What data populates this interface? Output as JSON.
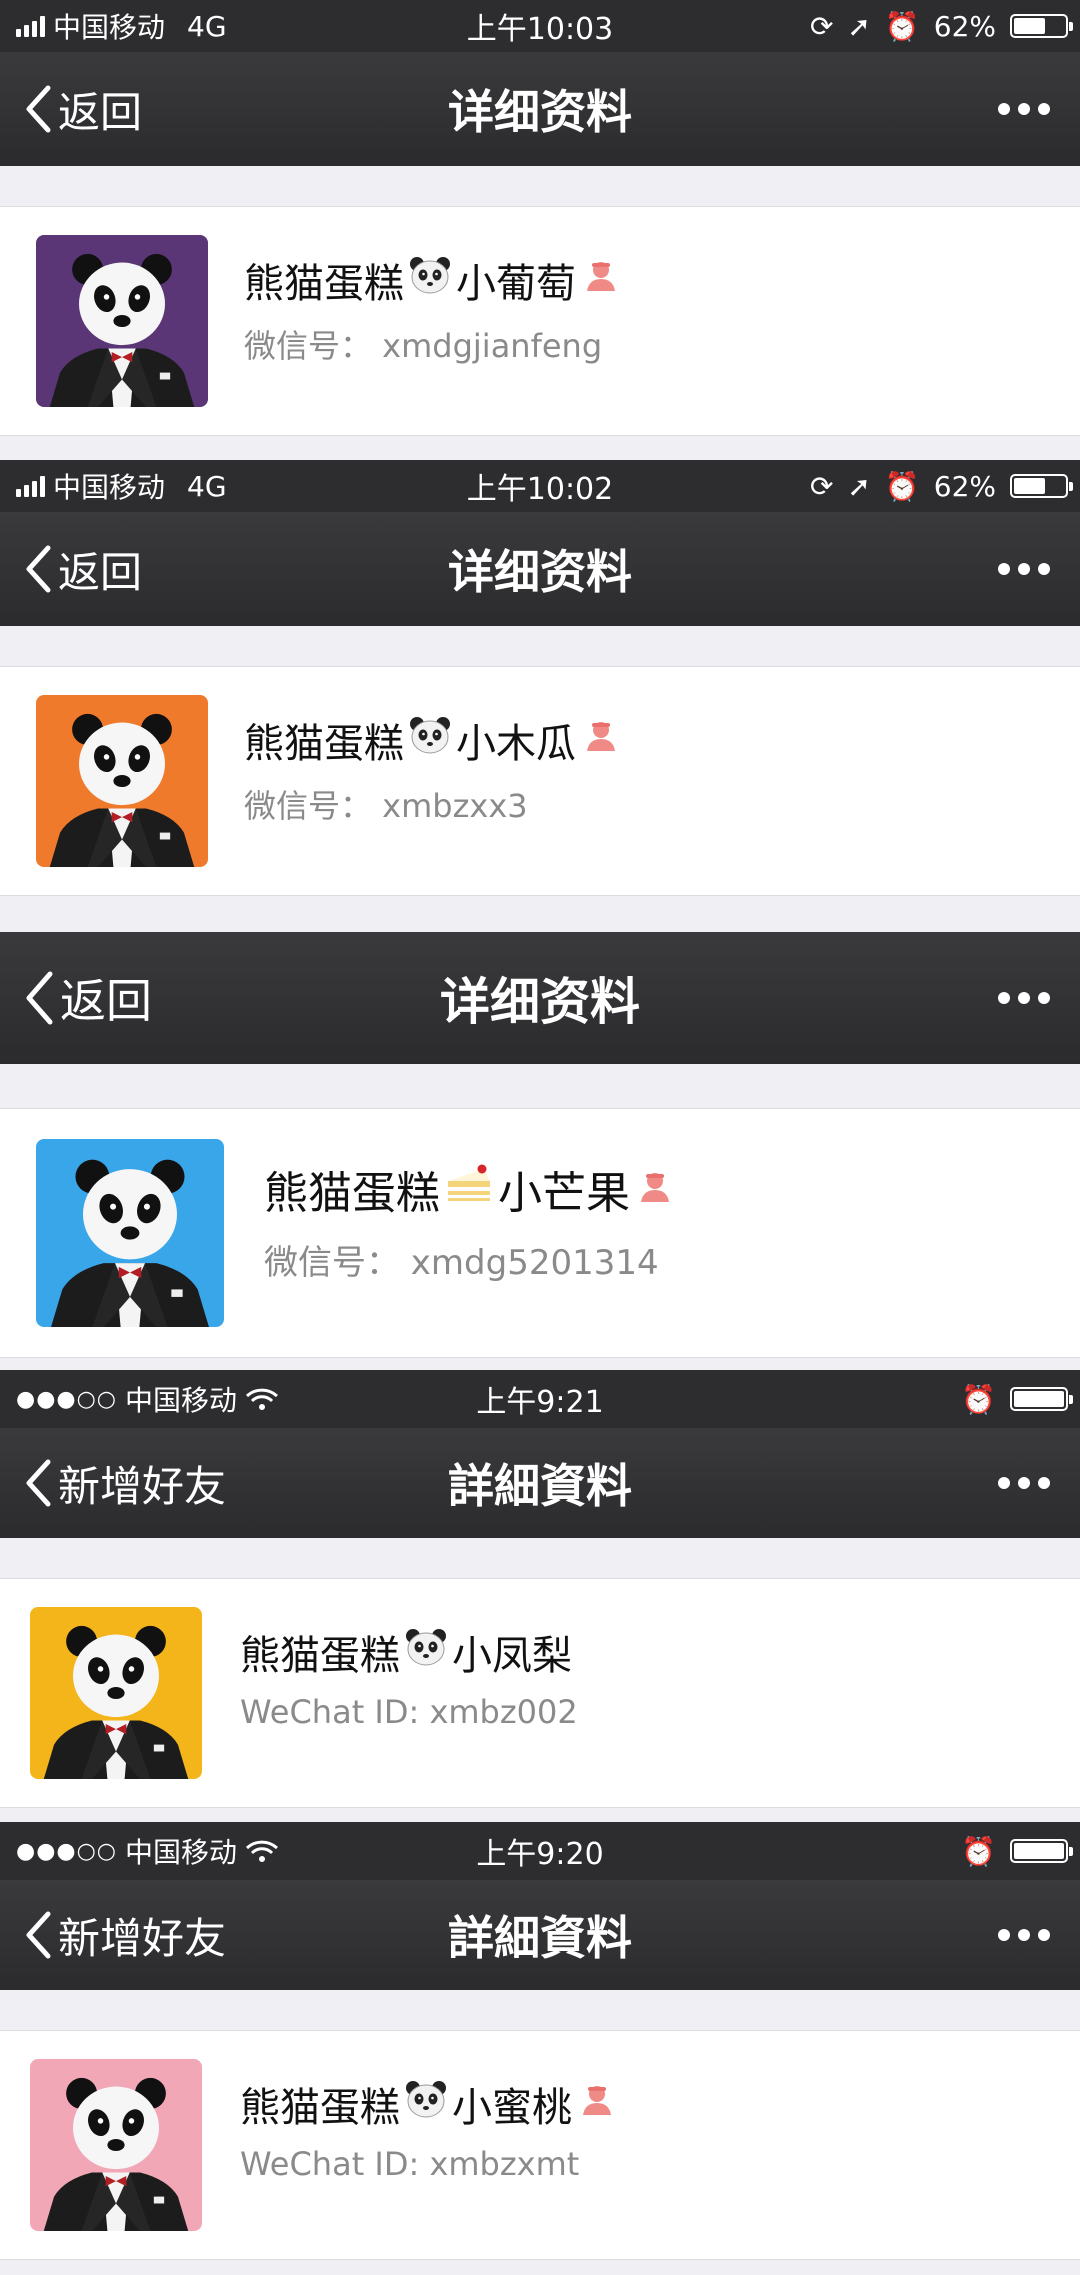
{
  "screens": [
    {
      "status": {
        "carrier": "中国移动",
        "network": "4G",
        "time": "上午10:03",
        "battery": "62%",
        "battery_level": 0.62
      },
      "nav": {
        "back": "返回",
        "title": "详细资料"
      },
      "profile": {
        "name_prefix": "熊猫蛋糕",
        "name_suffix": "小葡萄",
        "emoji_icon": "panda-face-icon",
        "female_icon": true,
        "id_text": "微信号：  xmdgjianfeng",
        "avatar_color": "#5a3676"
      }
    },
    {
      "status": {
        "carrier": "中国移动",
        "network": "4G",
        "time": "上午10:02",
        "battery": "62%",
        "battery_level": 0.62
      },
      "nav": {
        "back": "返回",
        "title": "详细资料"
      },
      "profile": {
        "name_prefix": "熊猫蛋糕",
        "name_suffix": "小木瓜",
        "emoji_icon": "panda-face-icon",
        "female_icon": true,
        "id_text": "微信号：  xmbzxx3",
        "avatar_color": "#f07a2c"
      }
    },
    {
      "nav": {
        "back": "返回",
        "title": "详细资料"
      },
      "profile": {
        "name_prefix": "熊猫蛋糕",
        "name_suffix": "小芒果",
        "emoji_icon": "cake-slice-icon",
        "female_icon": true,
        "id_text": "微信号：  xmdg5201314",
        "avatar_color": "#3aa6ea"
      }
    },
    {
      "status": {
        "carrier": "中国移动",
        "time": "上午9:21",
        "signal": "●●●○○"
      },
      "nav": {
        "back": "新增好友",
        "title": "詳細資料"
      },
      "profile": {
        "name_prefix": "熊猫蛋糕",
        "name_suffix": "小凤梨",
        "emoji_icon": "panda-face-icon",
        "female_icon": false,
        "id_text": "WeChat ID: xmbz002",
        "avatar_color": "#f3b51a"
      }
    },
    {
      "status": {
        "carrier": "中国移动",
        "time": "上午9:20",
        "signal": "●●●○○"
      },
      "nav": {
        "back": "新增好友",
        "title": "詳細資料"
      },
      "profile": {
        "name_prefix": "熊猫蛋糕",
        "name_suffix": "小蜜桃",
        "emoji_icon": "panda-face-icon",
        "female_icon": true,
        "id_text": "WeChat ID: xmbzxmt",
        "avatar_color": "#f2a7b7"
      }
    }
  ]
}
